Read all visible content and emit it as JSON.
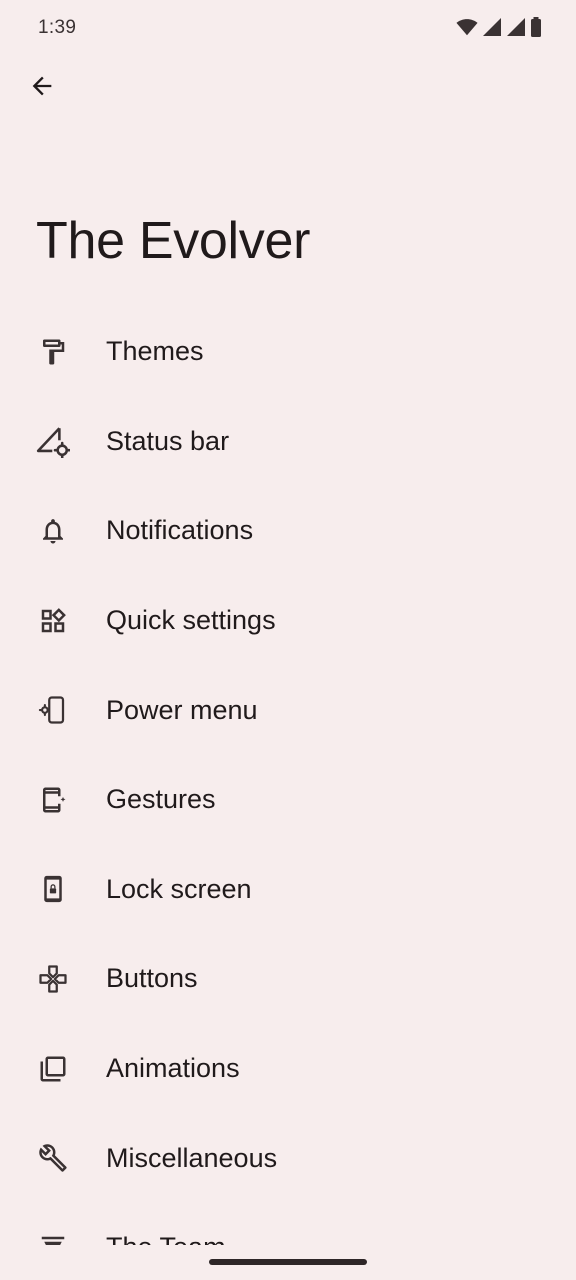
{
  "status_bar": {
    "time": "1:39",
    "icons": [
      "wifi-icon",
      "signal-icon",
      "signal-icon",
      "battery-icon"
    ]
  },
  "header": {
    "back_icon": "arrow-back-icon",
    "title": "The Evolver"
  },
  "menu": {
    "items": [
      {
        "label": "Themes",
        "icon": "paint-roller-icon"
      },
      {
        "label": "Status bar",
        "icon": "signal-settings-icon"
      },
      {
        "label": "Notifications",
        "icon": "bell-icon"
      },
      {
        "label": "Quick settings",
        "icon": "widgets-icon"
      },
      {
        "label": "Power menu",
        "icon": "phone-settings-icon"
      },
      {
        "label": "Gestures",
        "icon": "phone-sparkle-icon"
      },
      {
        "label": "Lock screen",
        "icon": "phone-lock-icon"
      },
      {
        "label": "Buttons",
        "icon": "gamepad-icon"
      },
      {
        "label": "Animations",
        "icon": "library-icon"
      },
      {
        "label": "Miscellaneous",
        "icon": "wrench-icon"
      },
      {
        "label": "The Team",
        "icon": "team-icon"
      }
    ]
  },
  "colors": {
    "background": "#f7eded",
    "text": "#201a1b",
    "icon": "#3a3233"
  }
}
